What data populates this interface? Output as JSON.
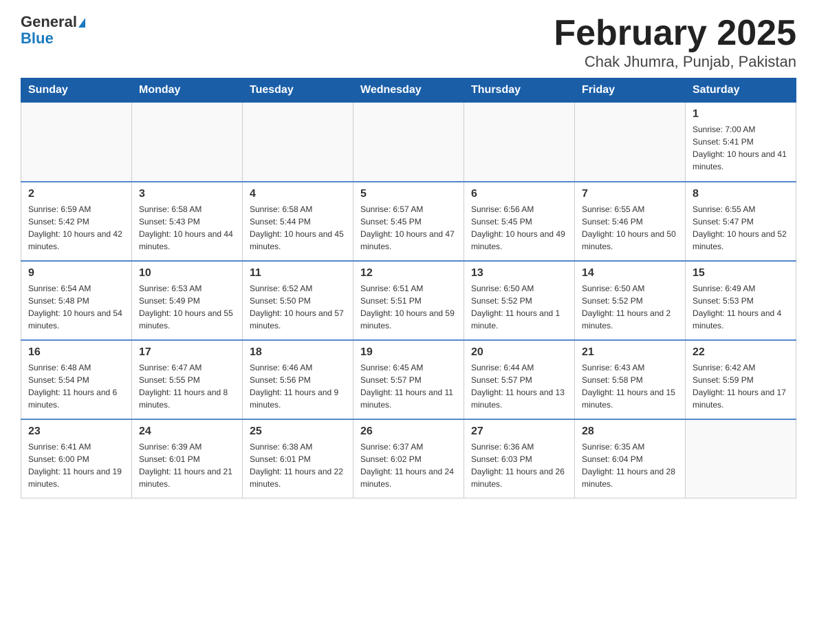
{
  "header": {
    "logo_general": "General",
    "logo_blue": "Blue",
    "title": "February 2025",
    "subtitle": "Chak Jhumra, Punjab, Pakistan"
  },
  "calendar": {
    "days_of_week": [
      "Sunday",
      "Monday",
      "Tuesday",
      "Wednesday",
      "Thursday",
      "Friday",
      "Saturday"
    ],
    "weeks": [
      [
        {
          "day": "",
          "info": ""
        },
        {
          "day": "",
          "info": ""
        },
        {
          "day": "",
          "info": ""
        },
        {
          "day": "",
          "info": ""
        },
        {
          "day": "",
          "info": ""
        },
        {
          "day": "",
          "info": ""
        },
        {
          "day": "1",
          "info": "Sunrise: 7:00 AM\nSunset: 5:41 PM\nDaylight: 10 hours and 41 minutes."
        }
      ],
      [
        {
          "day": "2",
          "info": "Sunrise: 6:59 AM\nSunset: 5:42 PM\nDaylight: 10 hours and 42 minutes."
        },
        {
          "day": "3",
          "info": "Sunrise: 6:58 AM\nSunset: 5:43 PM\nDaylight: 10 hours and 44 minutes."
        },
        {
          "day": "4",
          "info": "Sunrise: 6:58 AM\nSunset: 5:44 PM\nDaylight: 10 hours and 45 minutes."
        },
        {
          "day": "5",
          "info": "Sunrise: 6:57 AM\nSunset: 5:45 PM\nDaylight: 10 hours and 47 minutes."
        },
        {
          "day": "6",
          "info": "Sunrise: 6:56 AM\nSunset: 5:45 PM\nDaylight: 10 hours and 49 minutes."
        },
        {
          "day": "7",
          "info": "Sunrise: 6:55 AM\nSunset: 5:46 PM\nDaylight: 10 hours and 50 minutes."
        },
        {
          "day": "8",
          "info": "Sunrise: 6:55 AM\nSunset: 5:47 PM\nDaylight: 10 hours and 52 minutes."
        }
      ],
      [
        {
          "day": "9",
          "info": "Sunrise: 6:54 AM\nSunset: 5:48 PM\nDaylight: 10 hours and 54 minutes."
        },
        {
          "day": "10",
          "info": "Sunrise: 6:53 AM\nSunset: 5:49 PM\nDaylight: 10 hours and 55 minutes."
        },
        {
          "day": "11",
          "info": "Sunrise: 6:52 AM\nSunset: 5:50 PM\nDaylight: 10 hours and 57 minutes."
        },
        {
          "day": "12",
          "info": "Sunrise: 6:51 AM\nSunset: 5:51 PM\nDaylight: 10 hours and 59 minutes."
        },
        {
          "day": "13",
          "info": "Sunrise: 6:50 AM\nSunset: 5:52 PM\nDaylight: 11 hours and 1 minute."
        },
        {
          "day": "14",
          "info": "Sunrise: 6:50 AM\nSunset: 5:52 PM\nDaylight: 11 hours and 2 minutes."
        },
        {
          "day": "15",
          "info": "Sunrise: 6:49 AM\nSunset: 5:53 PM\nDaylight: 11 hours and 4 minutes."
        }
      ],
      [
        {
          "day": "16",
          "info": "Sunrise: 6:48 AM\nSunset: 5:54 PM\nDaylight: 11 hours and 6 minutes."
        },
        {
          "day": "17",
          "info": "Sunrise: 6:47 AM\nSunset: 5:55 PM\nDaylight: 11 hours and 8 minutes."
        },
        {
          "day": "18",
          "info": "Sunrise: 6:46 AM\nSunset: 5:56 PM\nDaylight: 11 hours and 9 minutes."
        },
        {
          "day": "19",
          "info": "Sunrise: 6:45 AM\nSunset: 5:57 PM\nDaylight: 11 hours and 11 minutes."
        },
        {
          "day": "20",
          "info": "Sunrise: 6:44 AM\nSunset: 5:57 PM\nDaylight: 11 hours and 13 minutes."
        },
        {
          "day": "21",
          "info": "Sunrise: 6:43 AM\nSunset: 5:58 PM\nDaylight: 11 hours and 15 minutes."
        },
        {
          "day": "22",
          "info": "Sunrise: 6:42 AM\nSunset: 5:59 PM\nDaylight: 11 hours and 17 minutes."
        }
      ],
      [
        {
          "day": "23",
          "info": "Sunrise: 6:41 AM\nSunset: 6:00 PM\nDaylight: 11 hours and 19 minutes."
        },
        {
          "day": "24",
          "info": "Sunrise: 6:39 AM\nSunset: 6:01 PM\nDaylight: 11 hours and 21 minutes."
        },
        {
          "day": "25",
          "info": "Sunrise: 6:38 AM\nSunset: 6:01 PM\nDaylight: 11 hours and 22 minutes."
        },
        {
          "day": "26",
          "info": "Sunrise: 6:37 AM\nSunset: 6:02 PM\nDaylight: 11 hours and 24 minutes."
        },
        {
          "day": "27",
          "info": "Sunrise: 6:36 AM\nSunset: 6:03 PM\nDaylight: 11 hours and 26 minutes."
        },
        {
          "day": "28",
          "info": "Sunrise: 6:35 AM\nSunset: 6:04 PM\nDaylight: 11 hours and 28 minutes."
        },
        {
          "day": "",
          "info": ""
        }
      ]
    ]
  }
}
